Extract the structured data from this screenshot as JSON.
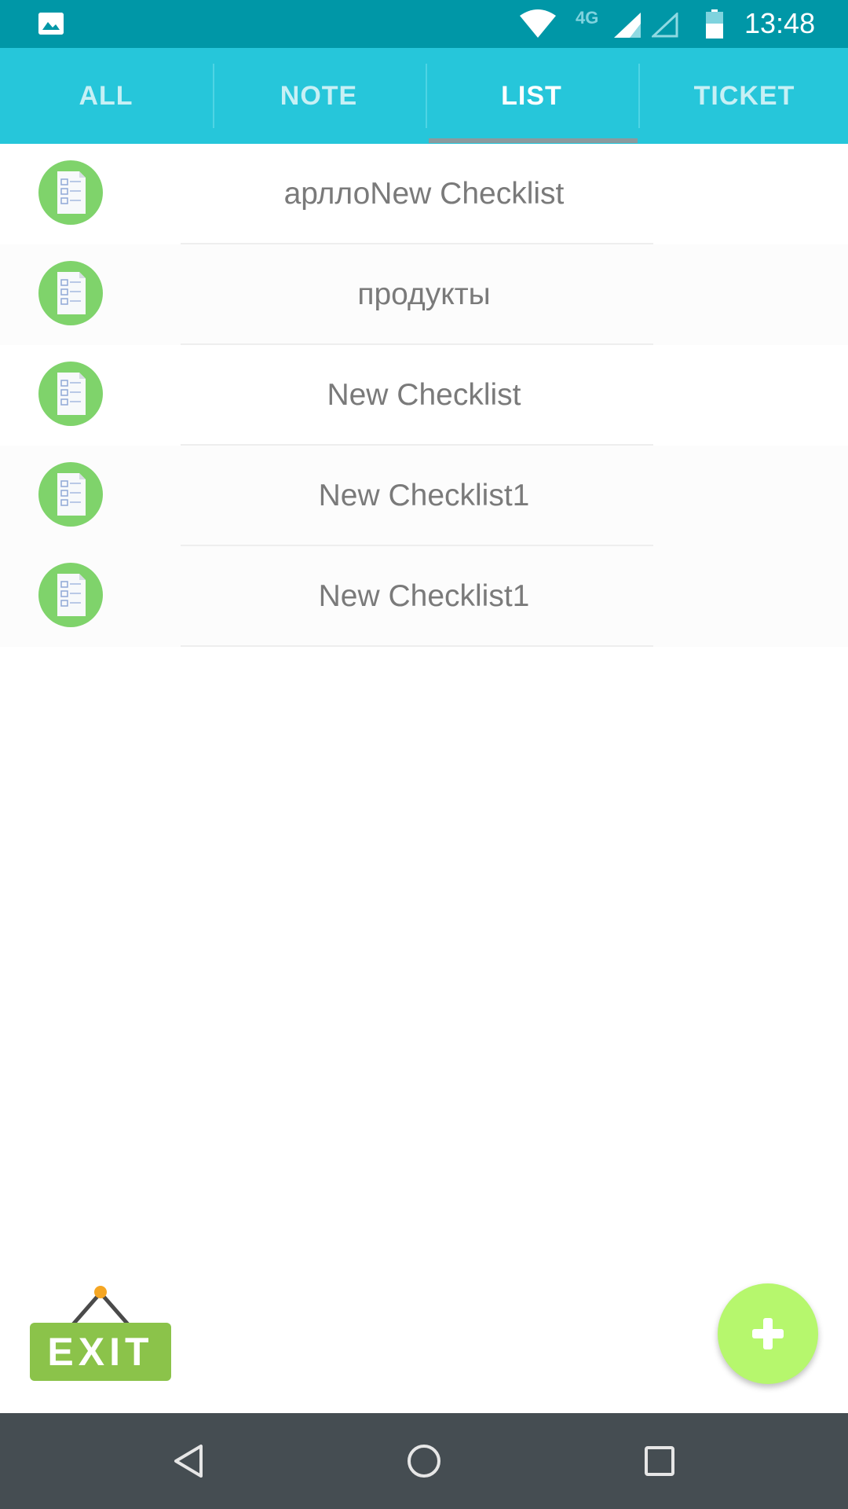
{
  "status_bar": {
    "network_type": "4G",
    "time": "13:48",
    "icons": [
      "gallery-icon",
      "wifi-icon",
      "signal-icon",
      "signal-empty-icon",
      "battery-icon"
    ]
  },
  "tabs": [
    {
      "label": "ALL",
      "active": false
    },
    {
      "label": "NOTE",
      "active": false
    },
    {
      "label": "LIST",
      "active": true
    },
    {
      "label": "TICKET",
      "active": false
    }
  ],
  "checklists": [
    {
      "title": "арллоNew Checklist",
      "icon": "checklist-icon"
    },
    {
      "title": "продукты",
      "icon": "checklist-icon"
    },
    {
      "title": "New Checklist",
      "icon": "checklist-icon"
    },
    {
      "title": "New Checklist1",
      "icon": "checklist-icon"
    },
    {
      "title": "New Checklist1",
      "icon": "checklist-icon"
    }
  ],
  "exit_button": {
    "label": "EXIT"
  },
  "fab": {
    "icon": "plus-icon"
  },
  "nav_bar": {
    "icons": [
      "back-icon",
      "home-icon",
      "recents-icon"
    ]
  },
  "colors": {
    "status_bar": "#0097a7",
    "tab_bar": "#26c6da",
    "icon_green": "#7fd36b",
    "fab_green": "#b6f76d",
    "exit_green": "#8bc34a",
    "nav_bar": "#454d52"
  }
}
